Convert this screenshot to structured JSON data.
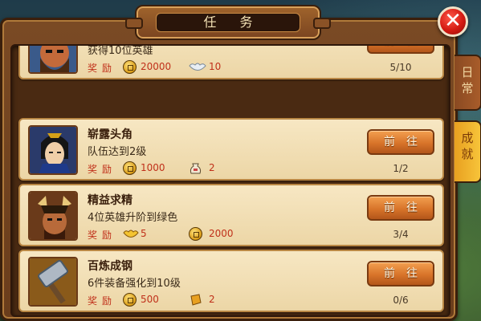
{
  "title": "任 务",
  "close_glyph": "✕",
  "side_tabs": [
    {
      "label": "日\n常",
      "active": false
    },
    {
      "label": "成\n就",
      "active": true
    }
  ],
  "reward_label": "奖励",
  "go_label": "前往",
  "tasks": [
    {
      "name": "",
      "desc": "获得10位英雄",
      "rewards": [
        {
          "icon": "gold-coin-icon",
          "value": "20000"
        },
        {
          "icon": "silver-ingot-icon",
          "value": "10"
        }
      ],
      "progress": "5/10"
    },
    {
      "name": "崭露头角",
      "desc": "队伍达到2级",
      "rewards": [
        {
          "icon": "gold-coin-icon",
          "value": "1000"
        },
        {
          "icon": "potion-bag-icon",
          "value": "2"
        }
      ],
      "progress": "1/2"
    },
    {
      "name": "精益求精",
      "desc": "4位英雄升阶到绿色",
      "rewards": [
        {
          "icon": "gold-ingot-icon",
          "value": "5"
        },
        {
          "icon": "gold-coin-icon",
          "value": "2000"
        }
      ],
      "progress": "3/4"
    },
    {
      "name": "百炼成钢",
      "desc": "6件装备强化到10级",
      "rewards": [
        {
          "icon": "gold-coin-icon",
          "value": "500"
        },
        {
          "icon": "forge-stone-icon",
          "value": "2"
        }
      ],
      "progress": "0/6"
    }
  ],
  "colors": {
    "accent": "#d8742a",
    "reward_text": "#c0301a",
    "card_bg": "#f7e7c3"
  }
}
